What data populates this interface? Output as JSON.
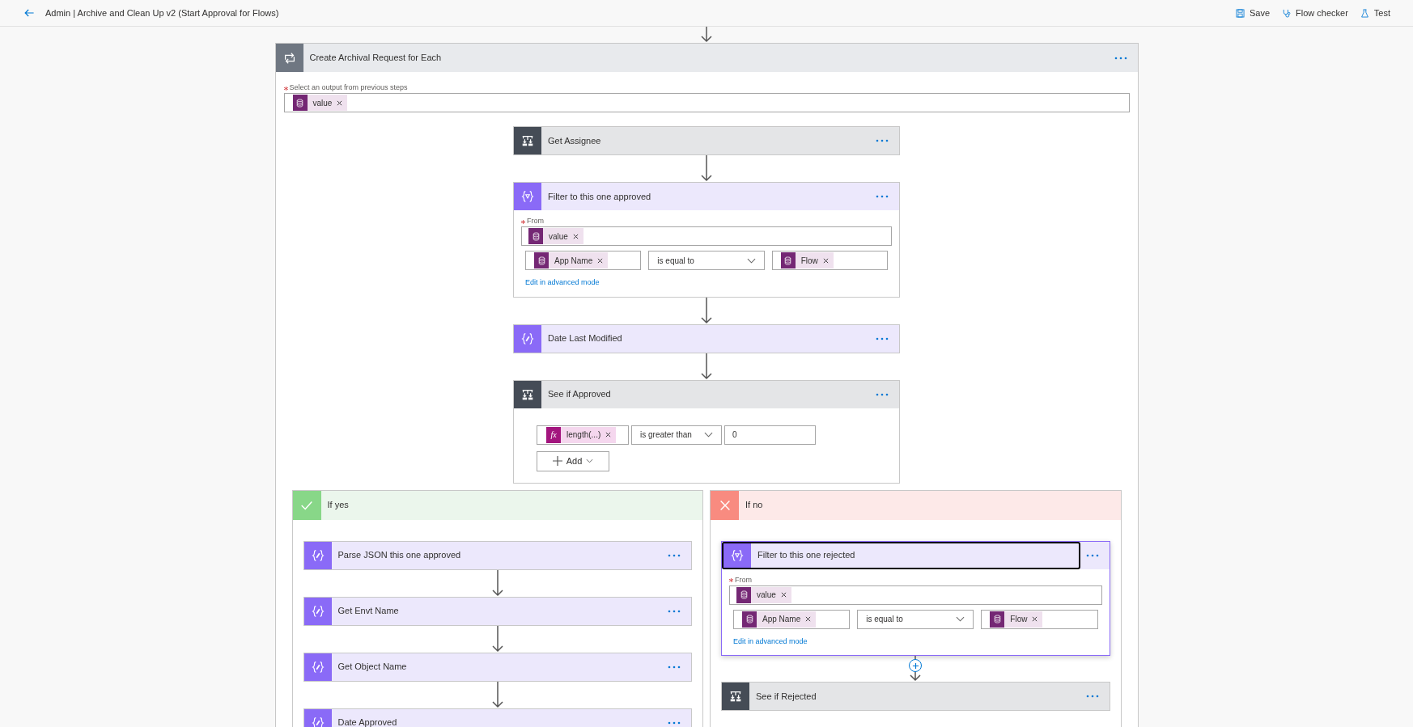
{
  "header": {
    "title": "Admin | Archive and Clean Up v2 (Start Approval for Flows)",
    "actions": [
      {
        "kind": "save",
        "label": "Save"
      },
      {
        "kind": "checker",
        "label": "Flow checker"
      },
      {
        "kind": "test",
        "label": "Test"
      }
    ]
  },
  "loop": {
    "kind": "foreach",
    "title": "Create Archival Request for Each",
    "field_label": "Select an output from previous steps",
    "required": true,
    "tokens": [
      {
        "kind": "data",
        "label": "value"
      }
    ],
    "steps": [
      {
        "kind": "control",
        "title": "Get Assignee",
        "selected": false,
        "insert_point": false
      },
      {
        "kind": "filter",
        "title": "Filter to this one approved",
        "selected": false,
        "insert_point": false,
        "from_label": "From",
        "required": true,
        "from_tokens": [
          {
            "kind": "data",
            "label": "value"
          }
        ],
        "left": {
          "kind": "data",
          "label": "App Name"
        },
        "operator": "is equal to",
        "right": {
          "kind": "data",
          "label": "Flow"
        },
        "link": "Edit in advanced mode"
      },
      {
        "kind": "compose",
        "title": "Date Last Modified",
        "selected": false,
        "insert_point": false
      },
      {
        "kind": "condition",
        "title": "See if Approved",
        "selected": false,
        "left": {
          "kind": "expression",
          "icon": "fx",
          "label": "length(...)"
        },
        "operator": "is greater than",
        "value": "0",
        "add_label": "Add"
      }
    ],
    "branches": [
      {
        "kind": "yes",
        "title": "If yes",
        "steps": [
          {
            "kind": "compose",
            "title": "Parse JSON this one approved",
            "selected": false,
            "insert_point": false
          },
          {
            "kind": "compose",
            "title": "Get Envt Name",
            "selected": false,
            "insert_point": false
          },
          {
            "kind": "compose",
            "title": "Get Object Name",
            "selected": false,
            "insert_point": false
          },
          {
            "kind": "compose",
            "title": "Date Approved",
            "selected": false
          }
        ]
      },
      {
        "kind": "no",
        "title": "If no",
        "steps": [
          {
            "kind": "filter",
            "title": "Filter to this one rejected",
            "selected": true,
            "insert_point": true,
            "from_label": "From",
            "required": true,
            "from_tokens": [
              {
                "kind": "data",
                "label": "value"
              }
            ],
            "left": {
              "kind": "data",
              "label": "App Name"
            },
            "operator": "is equal to",
            "right": {
              "kind": "data",
              "label": "Flow"
            },
            "link": "Edit in advanced mode"
          },
          {
            "kind": "control",
            "title": "See if Rejected",
            "selected": false
          }
        ]
      }
    ]
  }
}
